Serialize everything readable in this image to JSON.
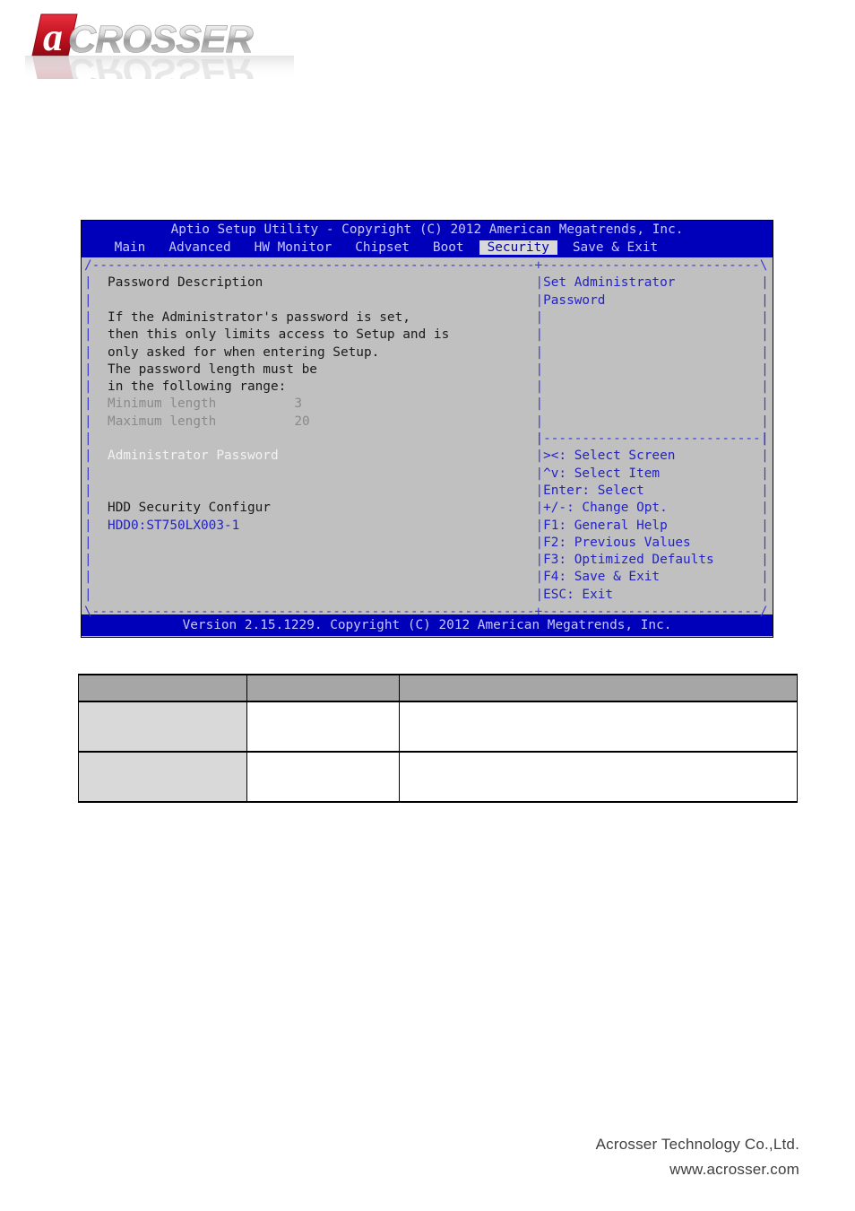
{
  "logo": {
    "brand": "ACROSSER",
    "mark_letter": "a",
    "brand_red": "#cc1122",
    "brand_gray": "#b3b3b3"
  },
  "bios": {
    "title": "Aptio Setup Utility - Copyright (C) 2012 American Megatrends, Inc.",
    "menu": [
      {
        "label": "Main",
        "active": false
      },
      {
        "label": "Advanced",
        "active": false
      },
      {
        "label": "HW Monitor",
        "active": false
      },
      {
        "label": "Chipset",
        "active": false
      },
      {
        "label": "Boot",
        "active": false
      },
      {
        "label": "Security",
        "active": true
      },
      {
        "label": "Save & Exit",
        "active": false
      }
    ],
    "left_panel": {
      "heading": "Password Description",
      "description": [
        "If the Administrator's password is set,",
        "then this only limits access to Setup and is",
        "only asked for when entering Setup.",
        "The password length must be",
        "in the following range:"
      ],
      "min_label": "Minimum length",
      "min_value": "3",
      "max_label": "Maximum length",
      "max_value": "20",
      "selected_item": "Administrator Password",
      "hdd_heading": "HDD Security Configur",
      "hdd_item": "HDD0:ST750LX003-1"
    },
    "right_panel": {
      "help_lines": [
        "Set Administrator",
        "Password"
      ],
      "keys": [
        "><: Select Screen",
        "^v: Select Item",
        "Enter: Select",
        "+/-: Change Opt.",
        "F1: General Help",
        "F2: Previous Values",
        "F3: Optimized Defaults",
        "F4: Save & Exit",
        "ESC: Exit"
      ]
    },
    "version_bar": "Version 2.15.1229. Copyright (C) 2012 American Megatrends, Inc.",
    "colors": {
      "background": "#c0c0c0",
      "chrome_blue": "#0000bb",
      "chrome_text": "#c8c8ff",
      "frame_blue": "#3a3ad0",
      "active_tab_bg": "#d9d9d9"
    }
  },
  "table": {
    "headers": [
      "",
      "",
      ""
    ],
    "rows": [
      [
        "",
        "",
        ""
      ],
      [
        "",
        "",
        ""
      ]
    ]
  },
  "footer": {
    "company": "Acrosser Technology Co.,Ltd.",
    "url": "www.acrosser.com"
  }
}
